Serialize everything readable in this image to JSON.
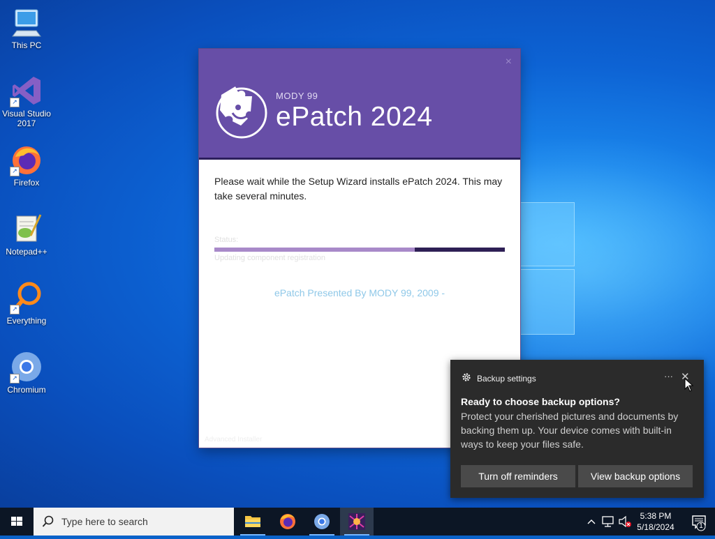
{
  "desktop": {
    "icons": [
      {
        "label": "This PC",
        "icon": "computer-icon"
      },
      {
        "label": "Visual Studio 2017",
        "icon": "visual-studio-icon"
      },
      {
        "label": "Firefox",
        "icon": "firefox-icon"
      },
      {
        "label": "Notepad++",
        "icon": "notepadpp-icon"
      },
      {
        "label": "Everything",
        "icon": "everything-search-icon"
      },
      {
        "label": "Chromium",
        "icon": "chromium-icon"
      }
    ]
  },
  "installer": {
    "brand": "MODY 99",
    "title": "ePatch 2024",
    "close_glyph": "×",
    "message": "Please wait while the Setup Wizard installs ePatch 2024.  This may take several minutes.",
    "status_label": "Status:",
    "progress_fraction": 0.69,
    "action_text": "Updating component registration",
    "credit": "ePatch Presented By MODY 99, 2009 -",
    "footer": "Advanced Installer",
    "colors": {
      "header": "#674ea7",
      "progress_bg": "#2e1f55",
      "progress_fill": "#a889c9"
    }
  },
  "toast": {
    "app_name": "Backup settings",
    "more_glyph": "···",
    "close_glyph": "✕",
    "title": "Ready to choose backup options?",
    "body": "Protect your cherished pictures and documents by backing them up. Your device comes with built-in ways to keep your files safe.",
    "button_left": "Turn off reminders",
    "button_right": "View backup options"
  },
  "taskbar": {
    "search_placeholder": "Type here to search",
    "apps": [
      "file-explorer-icon",
      "firefox-icon",
      "chromium-icon",
      "installer-app-icon"
    ],
    "time": "5:38 PM",
    "date": "5/18/2024",
    "notification_count": "1"
  }
}
